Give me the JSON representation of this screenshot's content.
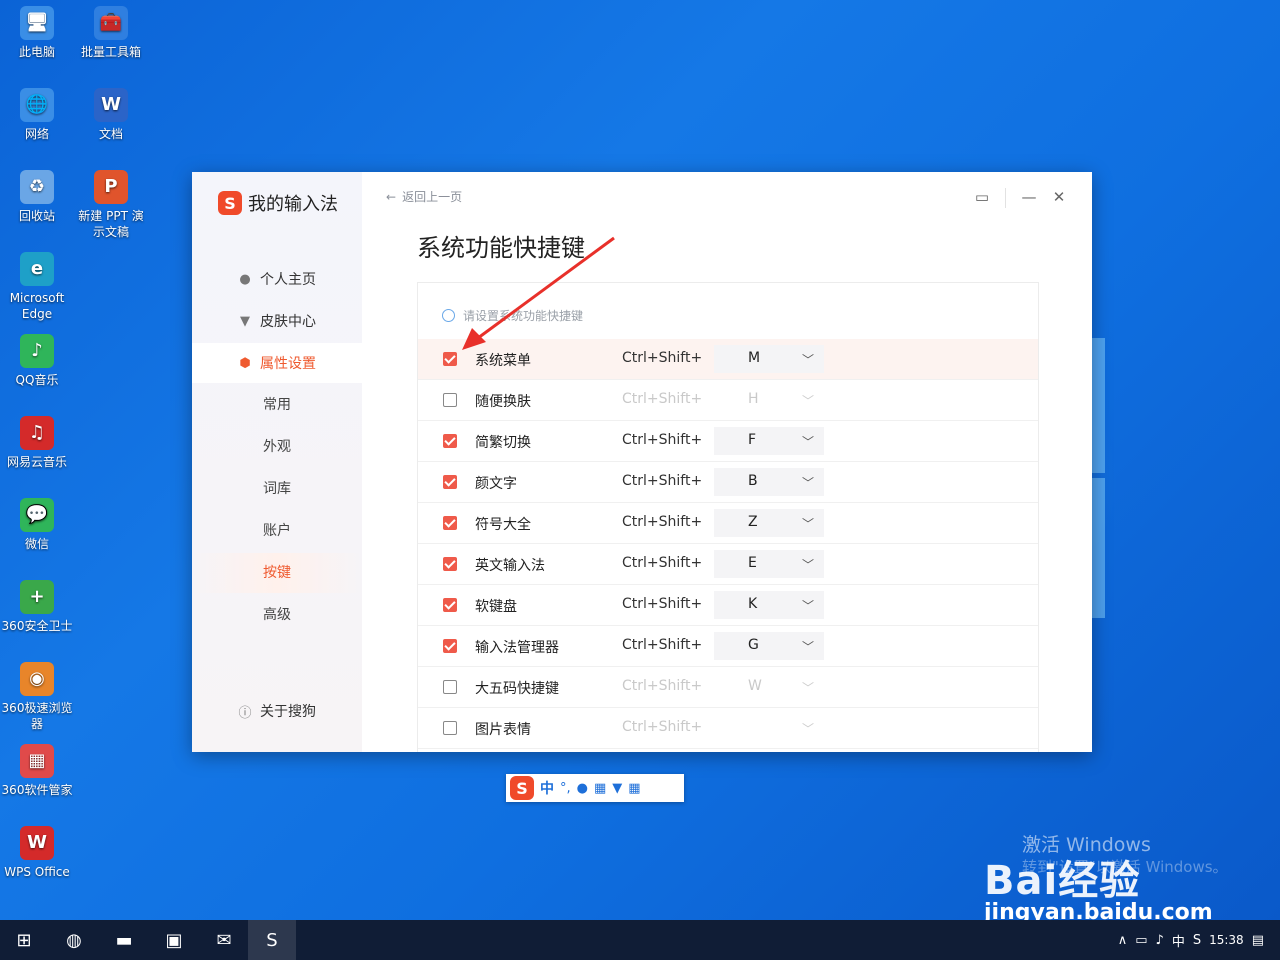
{
  "desktop": {
    "icons": [
      {
        "label": "此电脑",
        "glyph": "🖥",
        "color": "#3a8ee6"
      },
      {
        "label": "批量工具箱",
        "glyph": "🧰",
        "color": "#2f7fe0"
      },
      {
        "label": "网络",
        "glyph": "🌐",
        "color": "#3a8ee6"
      },
      {
        "label": "文档",
        "glyph": "W",
        "color": "#2b64c8"
      },
      {
        "label": "回收站",
        "glyph": "♻",
        "color": "#6aa6e6"
      },
      {
        "label": "新建 PPT 演示文稿",
        "glyph": "P",
        "color": "#e0542c"
      },
      {
        "label": "Microsoft Edge",
        "glyph": "e",
        "color": "#1ea0c8"
      },
      {
        "label": "QQ音乐",
        "glyph": "♪",
        "color": "#2fb55a"
      },
      {
        "label": "网易云音乐",
        "glyph": "♫",
        "color": "#d42a2a"
      },
      {
        "label": "微信",
        "glyph": "💬",
        "color": "#2fb55a"
      },
      {
        "label": "360安全卫士",
        "glyph": "+",
        "color": "#3aa84a"
      },
      {
        "label": "360极速浏览器",
        "glyph": "◉",
        "color": "#e8852a"
      },
      {
        "label": "360软件管家",
        "glyph": "▦",
        "color": "#e04a4a"
      },
      {
        "label": "WPS Office",
        "glyph": "W",
        "color": "#d42a2a"
      }
    ]
  },
  "window": {
    "brand_logo": "S",
    "brand_title": "我的输入法",
    "back_label": "返回上一页",
    "page_title": "系统功能快捷键",
    "hint": "请设置系统功能快捷键",
    "nav": [
      {
        "label": "个人主页",
        "icon": "user-icon",
        "glyph": "👤"
      },
      {
        "label": "皮肤中心",
        "icon": "shirt-icon",
        "glyph": "👕"
      },
      {
        "label": "属性设置",
        "icon": "settings-hex-icon",
        "glyph": "⬢"
      }
    ],
    "sub_nav": [
      "常用",
      "外观",
      "词库",
      "账户",
      "按键",
      "高级"
    ],
    "about": "关于搜狗",
    "rows": [
      {
        "checked": true,
        "label": "系统菜单",
        "combo": "Ctrl+Shift+",
        "key": "M"
      },
      {
        "checked": false,
        "label": "随便换肤",
        "combo": "Ctrl+Shift+",
        "key": "H"
      },
      {
        "checked": true,
        "label": "简繁切换",
        "combo": "Ctrl+Shift+",
        "key": "F"
      },
      {
        "checked": true,
        "label": "颜文字",
        "combo": "Ctrl+Shift+",
        "key": "B"
      },
      {
        "checked": true,
        "label": "符号大全",
        "combo": "Ctrl+Shift+",
        "key": "Z"
      },
      {
        "checked": true,
        "label": "英文输入法",
        "combo": "Ctrl+Shift+",
        "key": "E"
      },
      {
        "checked": true,
        "label": "软键盘",
        "combo": "Ctrl+Shift+",
        "key": "K"
      },
      {
        "checked": true,
        "label": "输入法管理器",
        "combo": "Ctrl+Shift+",
        "key": "G"
      },
      {
        "checked": false,
        "label": "大五码快捷键",
        "combo": "Ctrl+Shift+",
        "key": "W"
      },
      {
        "checked": false,
        "label": "图片表情",
        "combo": "Ctrl+Shift+",
        "key": ""
      }
    ]
  },
  "imebar": {
    "logo": "S",
    "mode": "中",
    "punct": "°,",
    "mic": "🎤",
    "keyboard": "⌨",
    "skin": "👕",
    "tools": "▦"
  },
  "watermark": {
    "activate": "激活 Windows",
    "activate_sub": "转到\"设置\"以激活 Windows。",
    "logo": "Bai经验",
    "url": "jingyan.baidu.com"
  },
  "taskbar": {
    "time": "15:38",
    "ime": "中",
    "apps": [
      "start",
      "edge",
      "explorer",
      "store",
      "mail",
      "sogou"
    ]
  },
  "colors": {
    "accent": "#ef5a2f",
    "checkbox": "#ef5a4a",
    "desktop": "#1578e6",
    "taskbar": "#101d36"
  }
}
